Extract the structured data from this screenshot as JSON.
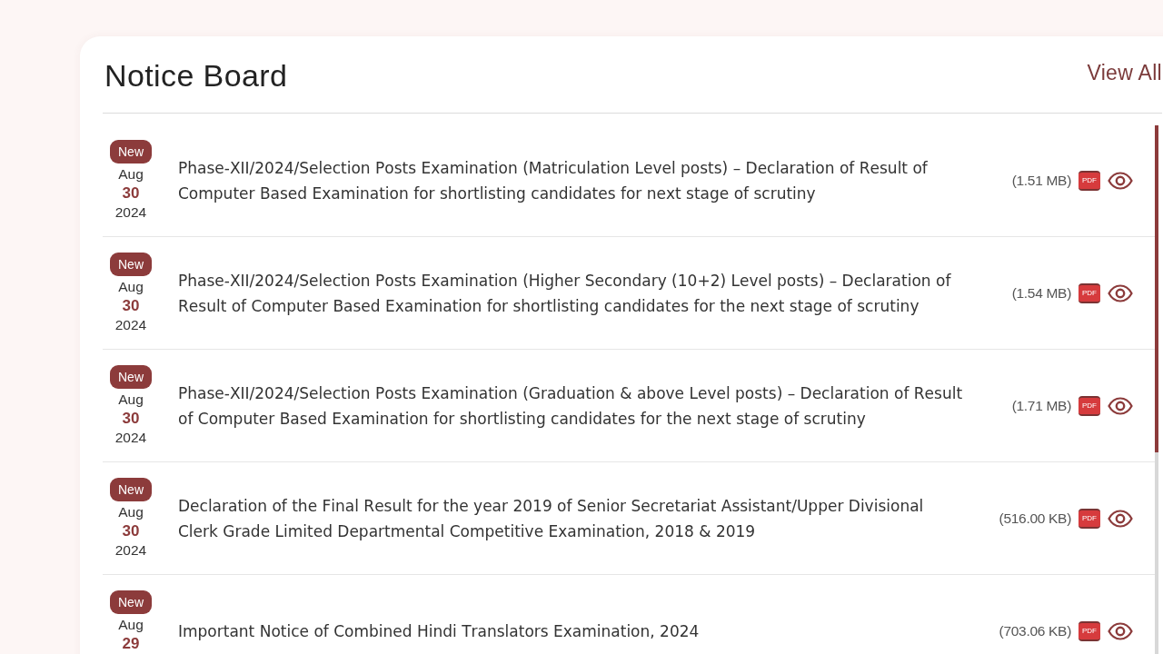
{
  "header": {
    "title": "Notice Board",
    "view_all": "View All"
  },
  "notices": [
    {
      "badge": "New",
      "month": "Aug",
      "day": "30",
      "year": "2024",
      "title": "Phase-XII/2024/Selection Posts Examination (Matriculation Level posts) – Declaration of Result of Computer Based Examination for shortlisting candidates for next stage of scrutiny",
      "size": "(1.51 MB)",
      "file_label": "PDF"
    },
    {
      "badge": "New",
      "month": "Aug",
      "day": "30",
      "year": "2024",
      "title": "Phase-XII/2024/Selection Posts Examination (Higher Secondary (10+2) Level posts) – Declaration of Result of Computer Based Examination for shortlisting candidates for the next stage of scrutiny",
      "size": "(1.54 MB)",
      "file_label": "PDF"
    },
    {
      "badge": "New",
      "month": "Aug",
      "day": "30",
      "year": "2024",
      "title": "Phase-XII/2024/Selection Posts Examination (Graduation & above Level posts) – Declaration of Result of Computer Based Examination for shortlisting candidates for the next stage of scrutiny",
      "size": "(1.71 MB)",
      "file_label": "PDF"
    },
    {
      "badge": "New",
      "month": "Aug",
      "day": "30",
      "year": "2024",
      "title": "Declaration of the Final Result for the year 2019 of Senior Secretariat Assistant/Upper Divisional Clerk Grade Limited Departmental Competitive Examination, 2018 & 2019",
      "size": "(516.00 KB)",
      "file_label": "PDF"
    },
    {
      "badge": "New",
      "month": "Aug",
      "day": "29",
      "title": "Important Notice of Combined Hindi Translators Examination, 2024",
      "size": "(703.06 KB)",
      "file_label": "PDF"
    }
  ]
}
